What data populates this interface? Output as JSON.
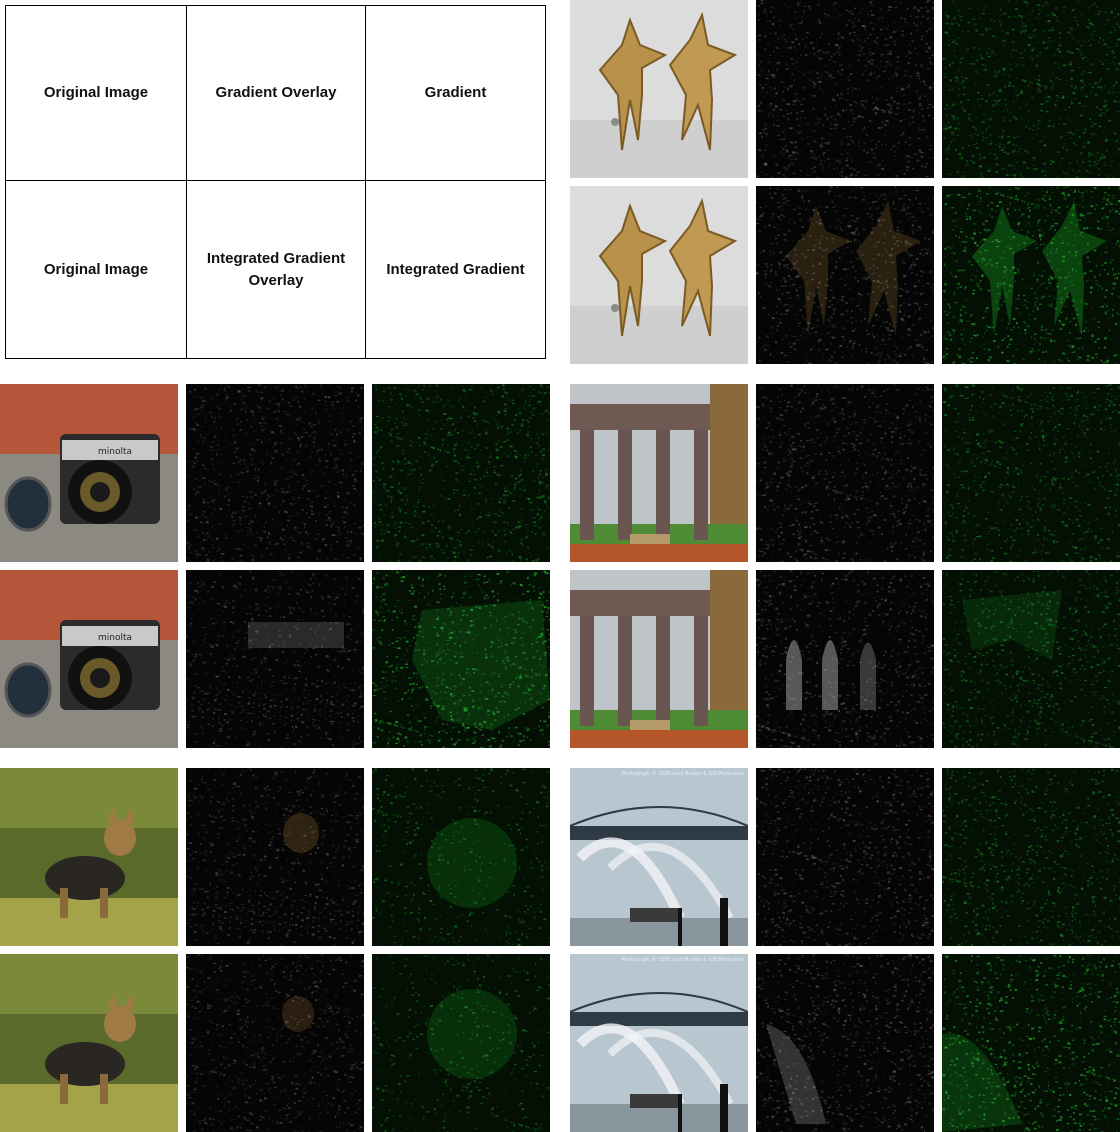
{
  "legend": {
    "row1": [
      "Original Image",
      "Gradient Overlay",
      "Gradient"
    ],
    "row2": [
      "Original Image",
      "Integrated Gradient Overlay",
      "Integrated Gradient"
    ]
  },
  "examples": [
    {
      "subject": "starfish earrings",
      "method": "gradient"
    },
    {
      "subject": "starfish earrings",
      "method": "integrated-gradient"
    },
    {
      "subject": "camera",
      "method": "gradient"
    },
    {
      "subject": "camera",
      "method": "integrated-gradient"
    },
    {
      "subject": "viaduct",
      "method": "gradient"
    },
    {
      "subject": "viaduct",
      "method": "integrated-gradient"
    },
    {
      "subject": "dog",
      "method": "gradient"
    },
    {
      "subject": "dog",
      "method": "integrated-gradient"
    },
    {
      "subject": "fireboat",
      "method": "gradient"
    },
    {
      "subject": "fireboat",
      "method": "integrated-gradient"
    }
  ],
  "photo_credit": "Photograph © 2005 Lord Bruker & ILB/Photosites",
  "colors": {
    "overlay_bg": "#050505",
    "gradient_bg": "#031003",
    "gradient_green": "#2fd13a",
    "grey_speckle": "#bdbdbd"
  }
}
